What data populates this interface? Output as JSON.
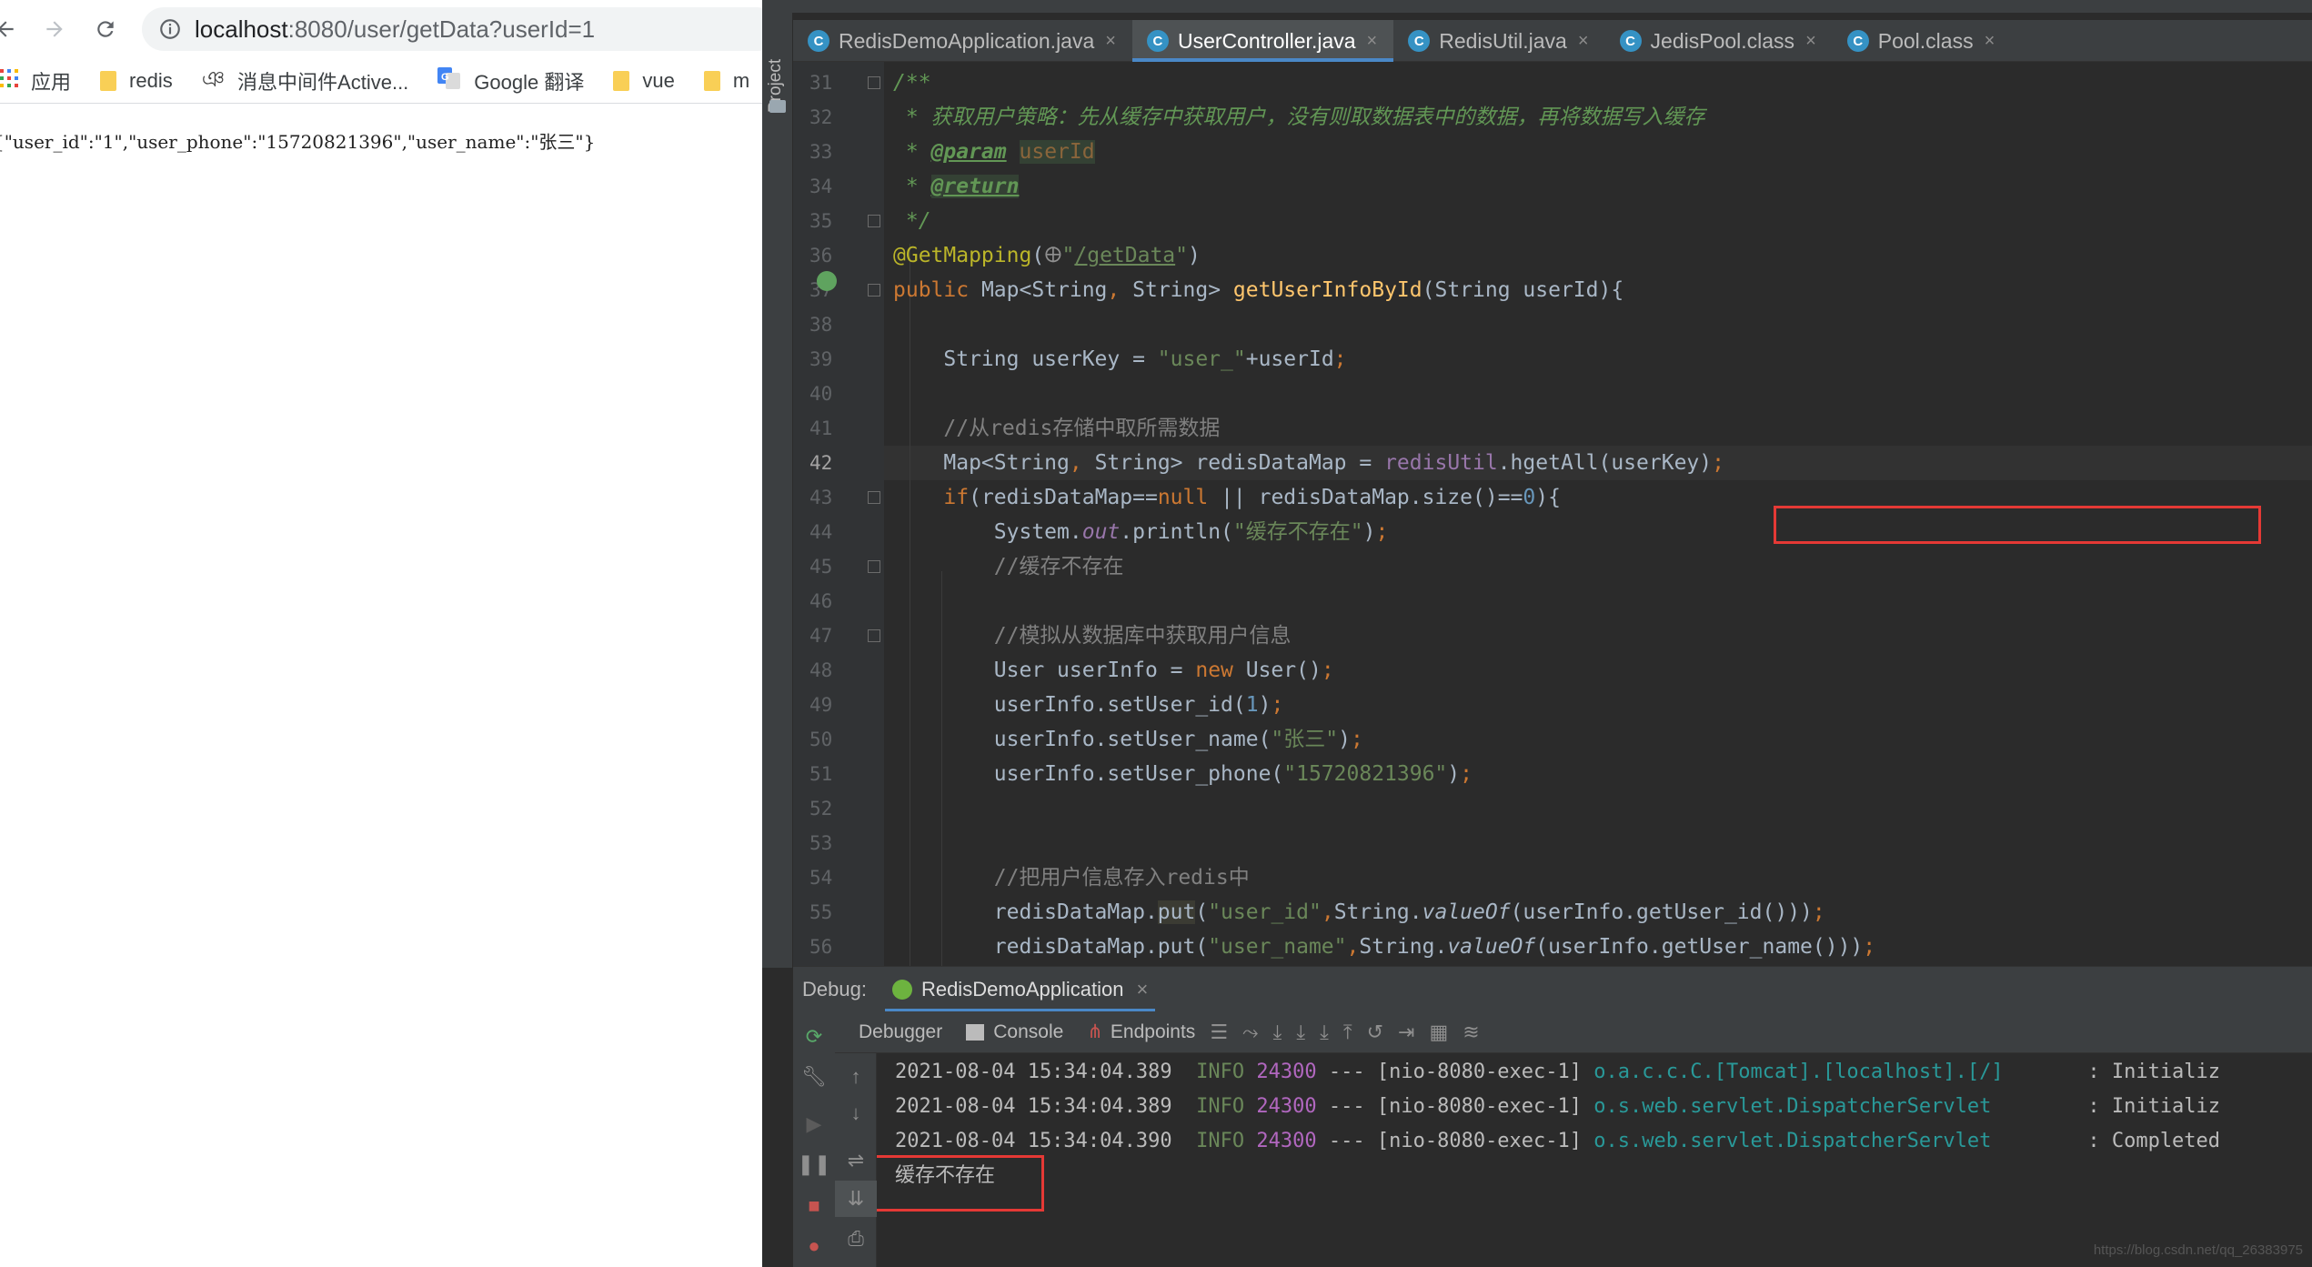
{
  "browser": {
    "url_host": "localhost",
    "url_path": ":8080/user/getData?userId=1",
    "bookmarks": [
      {
        "label": "应用",
        "icon": "apps-grid-icon"
      },
      {
        "label": "redis",
        "icon": "folder-icon"
      },
      {
        "label": "消息中间件Active...",
        "icon": "bookmark-glyph-icon"
      },
      {
        "label": "Google 翻译",
        "icon": "google-translate-icon"
      },
      {
        "label": "vue",
        "icon": "folder-icon"
      },
      {
        "label": "m",
        "icon": "folder-icon"
      }
    ],
    "page_text": "{\"user_id\":\"1\",\"user_phone\":\"15720821396\",\"user_name\":\"张三\"}"
  },
  "ide": {
    "side_panel_label": "Project",
    "tabs": [
      {
        "label": "RedisDemoApplication.java",
        "active": false
      },
      {
        "label": "UserController.java",
        "active": true
      },
      {
        "label": "RedisUtil.java",
        "active": false
      },
      {
        "label": "JedisPool.class",
        "active": false
      },
      {
        "label": "Pool.class",
        "active": false
      }
    ],
    "line_numbers": [
      "31",
      "32",
      "33",
      "34",
      "35",
      "36",
      "37",
      "38",
      "39",
      "40",
      "41",
      "42",
      "43",
      "44",
      "45",
      "46",
      "47",
      "48",
      "49",
      "50",
      "51",
      "52",
      "53",
      "54",
      "55",
      "56"
    ],
    "current_line": "42",
    "debug": {
      "label": "Debug:",
      "config_name": "RedisDemoApplication",
      "tabs": [
        "Debugger",
        "Console",
        "Endpoints"
      ],
      "log_lines": [
        {
          "ts": "2021-08-04 15:34:04.389",
          "level": "INFO",
          "pid": "24300",
          "sep": "---",
          "thread": "[nio-8080-exec-1]",
          "logger": "o.a.c.c.C.[Tomcat].[localhost].[/]",
          "msg": ": Initializ"
        },
        {
          "ts": "2021-08-04 15:34:04.389",
          "level": "INFO",
          "pid": "24300",
          "sep": "---",
          "thread": "[nio-8080-exec-1]",
          "logger": "o.s.web.servlet.DispatcherServlet",
          "msg": ": Initializ"
        },
        {
          "ts": "2021-08-04 15:34:04.390",
          "level": "INFO",
          "pid": "24300",
          "sep": "---",
          "thread": "[nio-8080-exec-1]",
          "logger": "o.s.web.servlet.DispatcherServlet",
          "msg": ": Completed"
        }
      ],
      "output_text": "缓存不存在"
    }
  },
  "watermark": "https://blog.csdn.net/qq_26383975",
  "colors": {
    "ide_bg": "#2b2b2b",
    "keyword": "#cc7832",
    "string": "#6a8759",
    "number": "#6897bb",
    "highlight_box": "#e53935"
  }
}
